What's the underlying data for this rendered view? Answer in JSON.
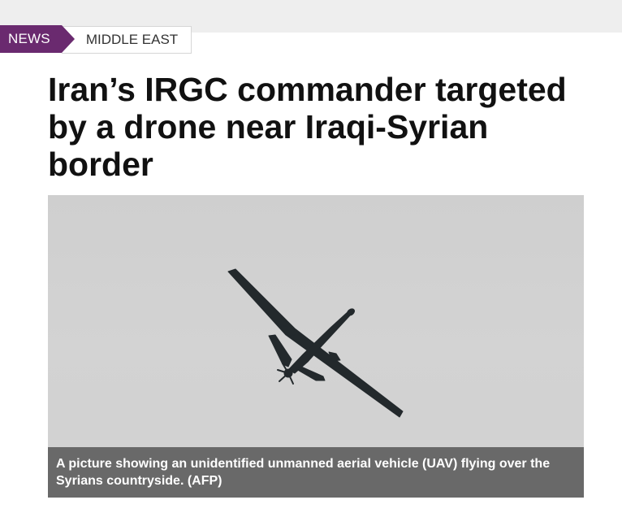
{
  "breadcrumb": {
    "category": "NEWS",
    "section": "MIDDLE EAST"
  },
  "article": {
    "headline": "Iran’s IRGC commander targeted by a drone near Iraqi-Syrian border",
    "image": {
      "subject": "drone-icon",
      "caption": "A picture showing an unidentified unmanned aerial vehicle (UAV) flying over the Syrians countryside. (AFP)"
    }
  },
  "colors": {
    "category_bg": "#6a2a6f",
    "sky": "#d1d1d1",
    "caption_bg": "#5a5a5a"
  }
}
